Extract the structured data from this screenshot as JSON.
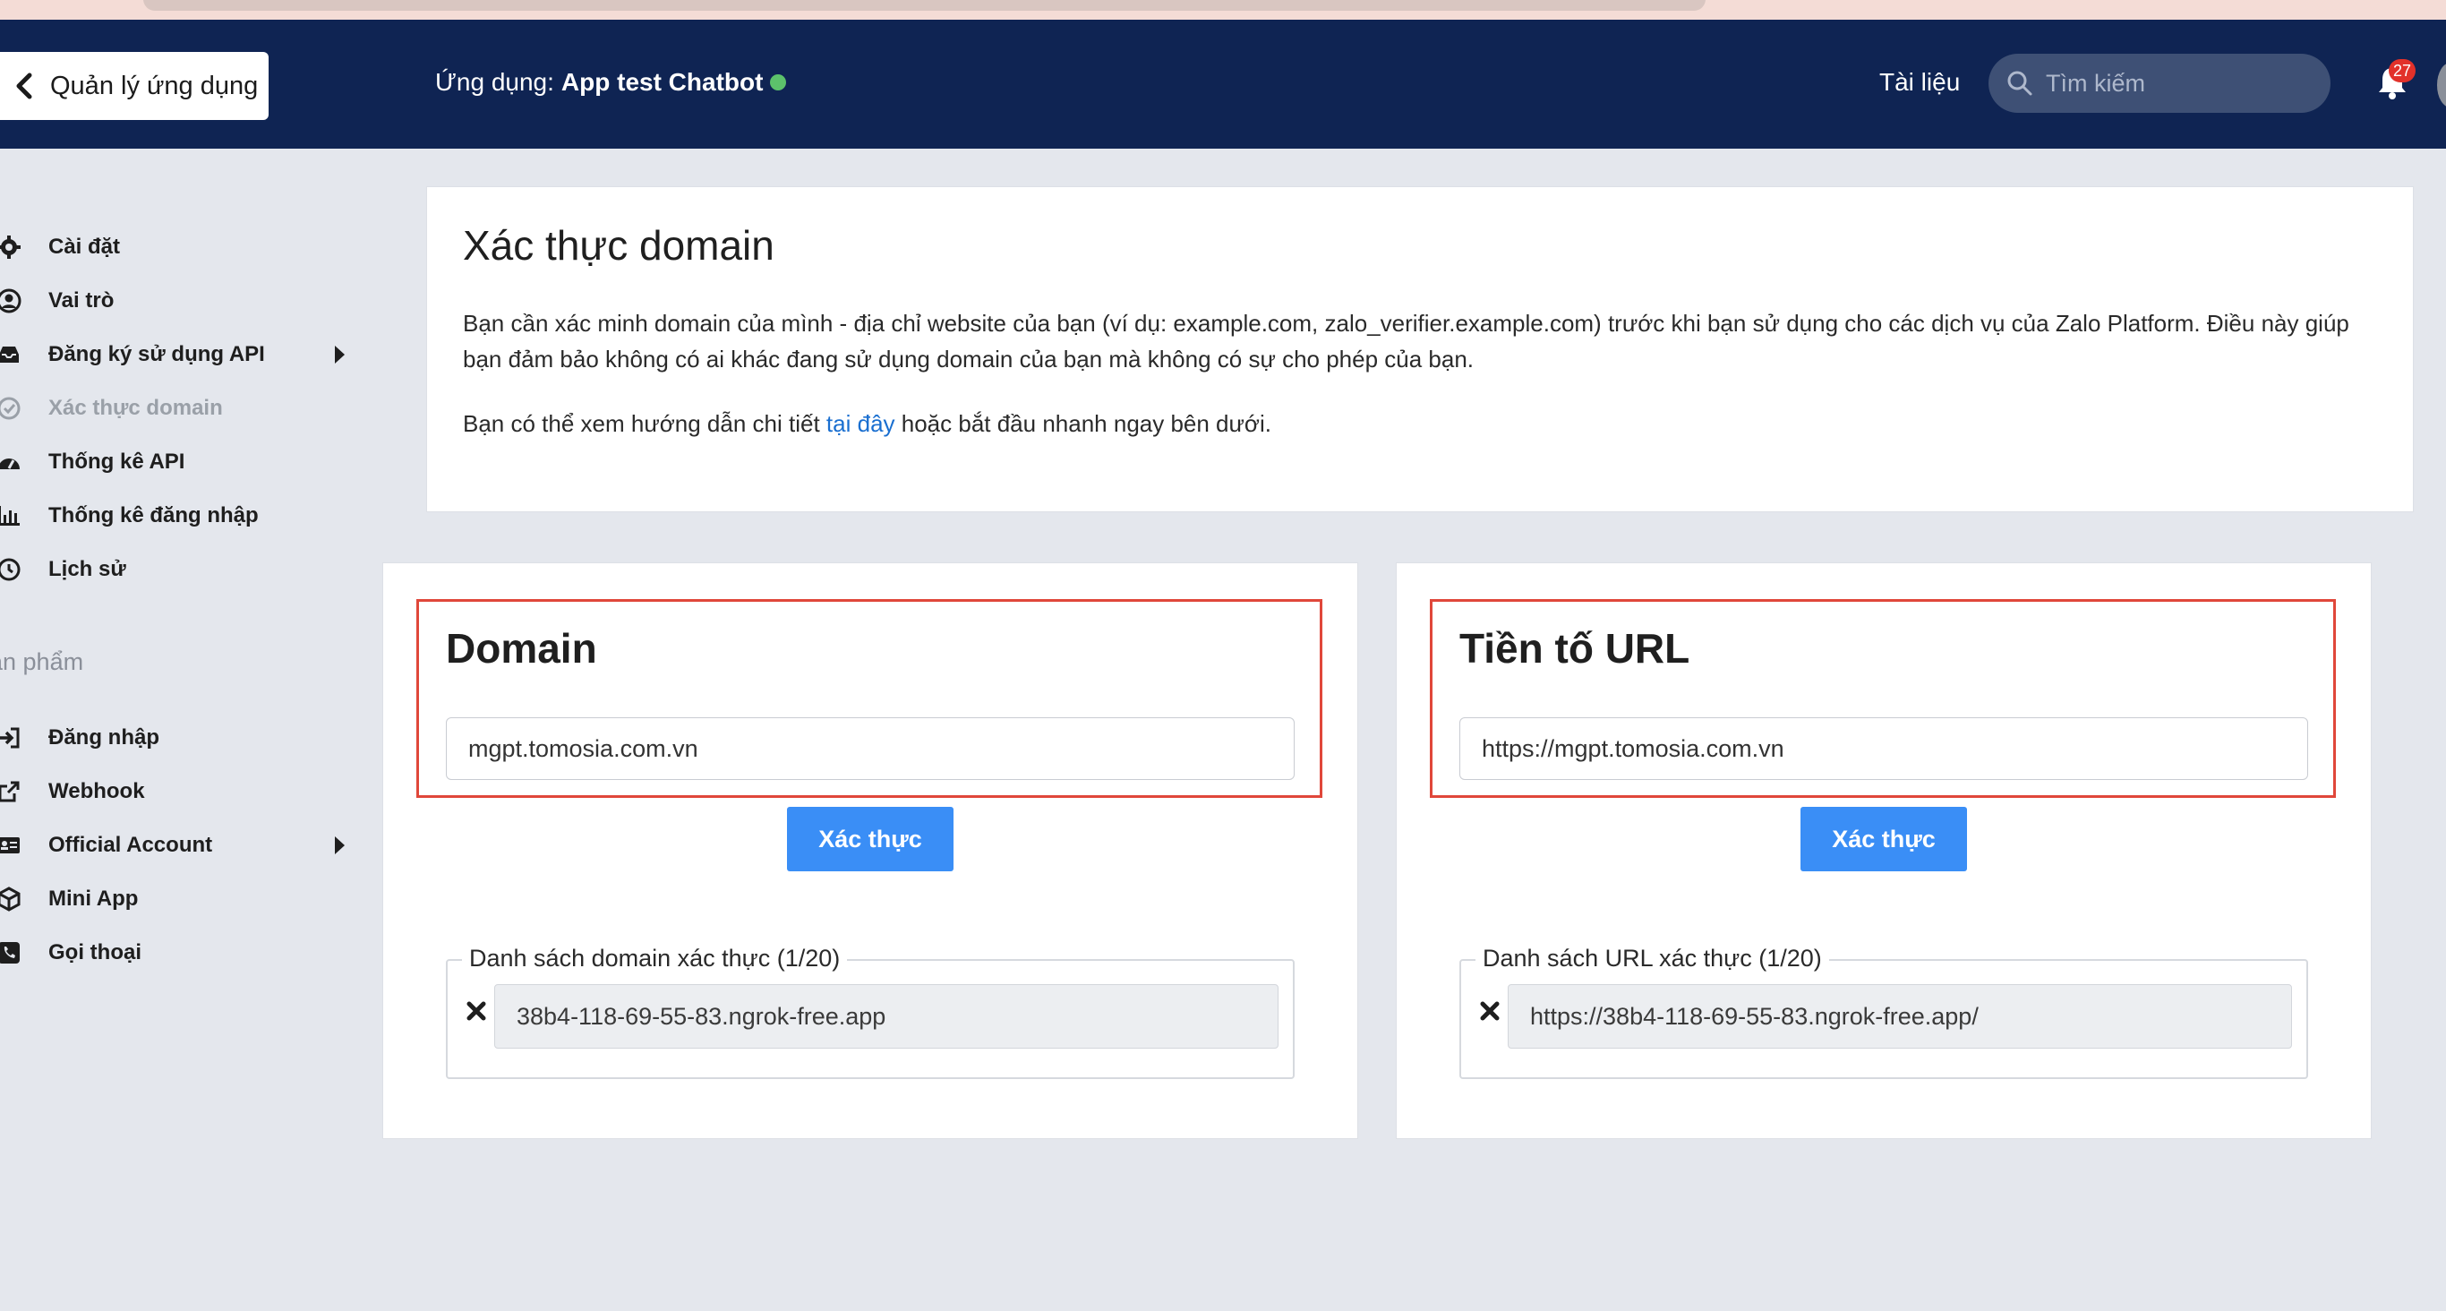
{
  "header": {
    "back_label": "Quản lý ứng dụng",
    "app_prefix": "Ứng dụng:",
    "app_name": "App test Chatbot",
    "docs_label": "Tài liệu",
    "search_placeholder": "Tìm kiếm",
    "notification_count": "27"
  },
  "sidebar": {
    "items": [
      {
        "label": "Cài đặt",
        "icon": "gear-icon"
      },
      {
        "label": "Vai trò",
        "icon": "user-circle-icon"
      },
      {
        "label": "Đăng ký sử dụng API",
        "icon": "inbox-icon",
        "has_submenu": true
      },
      {
        "label": "Xác thực domain",
        "icon": "check-circle-icon",
        "active": true
      },
      {
        "label": "Thống kê API",
        "icon": "dashboard-icon"
      },
      {
        "label": "Thống kê đăng nhập",
        "icon": "bar-chart-icon"
      },
      {
        "label": "Lịch sử",
        "icon": "history-icon"
      }
    ],
    "section_label": "ản phẩm",
    "product_items": [
      {
        "label": "Đăng nhập",
        "icon": "sign-in-icon"
      },
      {
        "label": "Webhook",
        "icon": "external-link-icon"
      },
      {
        "label": "Official Account",
        "icon": "id-card-icon",
        "has_submenu": true
      },
      {
        "label": "Mini App",
        "icon": "cube-icon"
      },
      {
        "label": "Gọi thoại",
        "icon": "phone-icon"
      }
    ]
  },
  "intro": {
    "title": "Xác thực domain",
    "paragraph1": "Bạn cần xác minh domain của mình - địa chỉ website của bạn (ví dụ: example.com, zalo_verifier.example.com) trước khi bạn sử dụng cho các dịch vụ của Zalo Platform. Điều này giúp bạn đảm bảo không có ai khác đang sử dụng domain của bạn mà không có sự cho phép của bạn.",
    "paragraph2_before": "Bạn có thể xem hướng dẫn chi tiết ",
    "paragraph2_link": "tại đây",
    "paragraph2_after": " hoặc bắt đầu nhanh ngay bên dưới."
  },
  "domain_card": {
    "title": "Domain",
    "input_value": "mgpt.tomosia.com.vn",
    "button_label": "Xác thực",
    "list_legend": "Danh sách domain xác thực (1/20)",
    "list_items": [
      "38b4-118-69-55-83.ngrok-free.app"
    ]
  },
  "url_card": {
    "title": "Tiền tố URL",
    "input_value": "https://mgpt.tomosia.com.vn",
    "button_label": "Xác thực",
    "list_legend": "Danh sách URL xác thực (1/20)",
    "list_items": [
      "https://38b4-118-69-55-83.ngrok-free.app/"
    ]
  },
  "colors": {
    "header_bg": "#0f2453",
    "accent_blue": "#3a8ef6",
    "highlight_red": "#e0473a",
    "status_green": "#5cc26b"
  }
}
